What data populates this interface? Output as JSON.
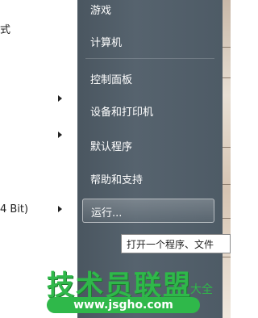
{
  "left_pane": {
    "items": [
      {
        "label": "式"
      },
      {
        "label": "4 Bit)"
      }
    ]
  },
  "start_menu": {
    "items": [
      {
        "label": "游戏"
      },
      {
        "label": "计算机"
      },
      {
        "label": "控制面板"
      },
      {
        "label": "设备和打印机"
      },
      {
        "label": "默认程序"
      },
      {
        "label": "帮助和支持"
      },
      {
        "label": "运行..."
      }
    ]
  },
  "tooltip": {
    "text": "打开一个程序、文件"
  },
  "watermark": {
    "brand": "技术员联盟",
    "small": "大全",
    "url": "www.jsgho.com"
  },
  "colors": {
    "menu_bg": "#4f5c67",
    "watermark_green": "#2fb84a"
  }
}
